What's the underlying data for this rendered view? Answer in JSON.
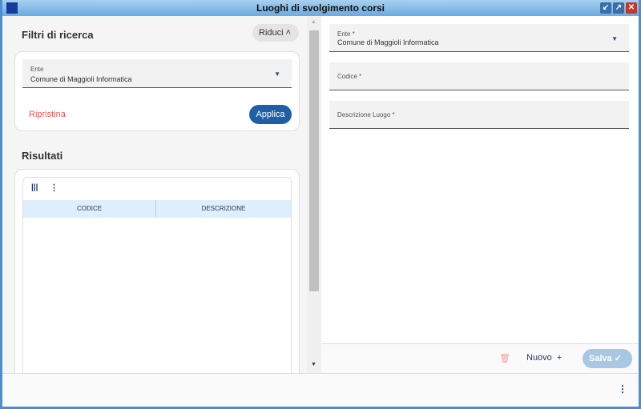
{
  "window": {
    "title": "Luoghi di svolgimento corsi"
  },
  "filters": {
    "title": "Filtri di ricerca",
    "collapse_label": "Riduci",
    "ente_label": "Ente",
    "ente_value": "Comune di Maggioli Informatica",
    "reset_label": "Ripristina",
    "apply_label": "Applica"
  },
  "results": {
    "title": "Risultati",
    "columns": [
      "CODICE",
      "DESCRIZIONE"
    ]
  },
  "form": {
    "ente_label": "Ente *",
    "ente_value": "Comune di Maggioli Informatica",
    "codice_label": "Codice *",
    "descrizione_label": "Descrizione Luogo *"
  },
  "actions": {
    "new_label": "Nuovo",
    "save_label": "Salva"
  }
}
